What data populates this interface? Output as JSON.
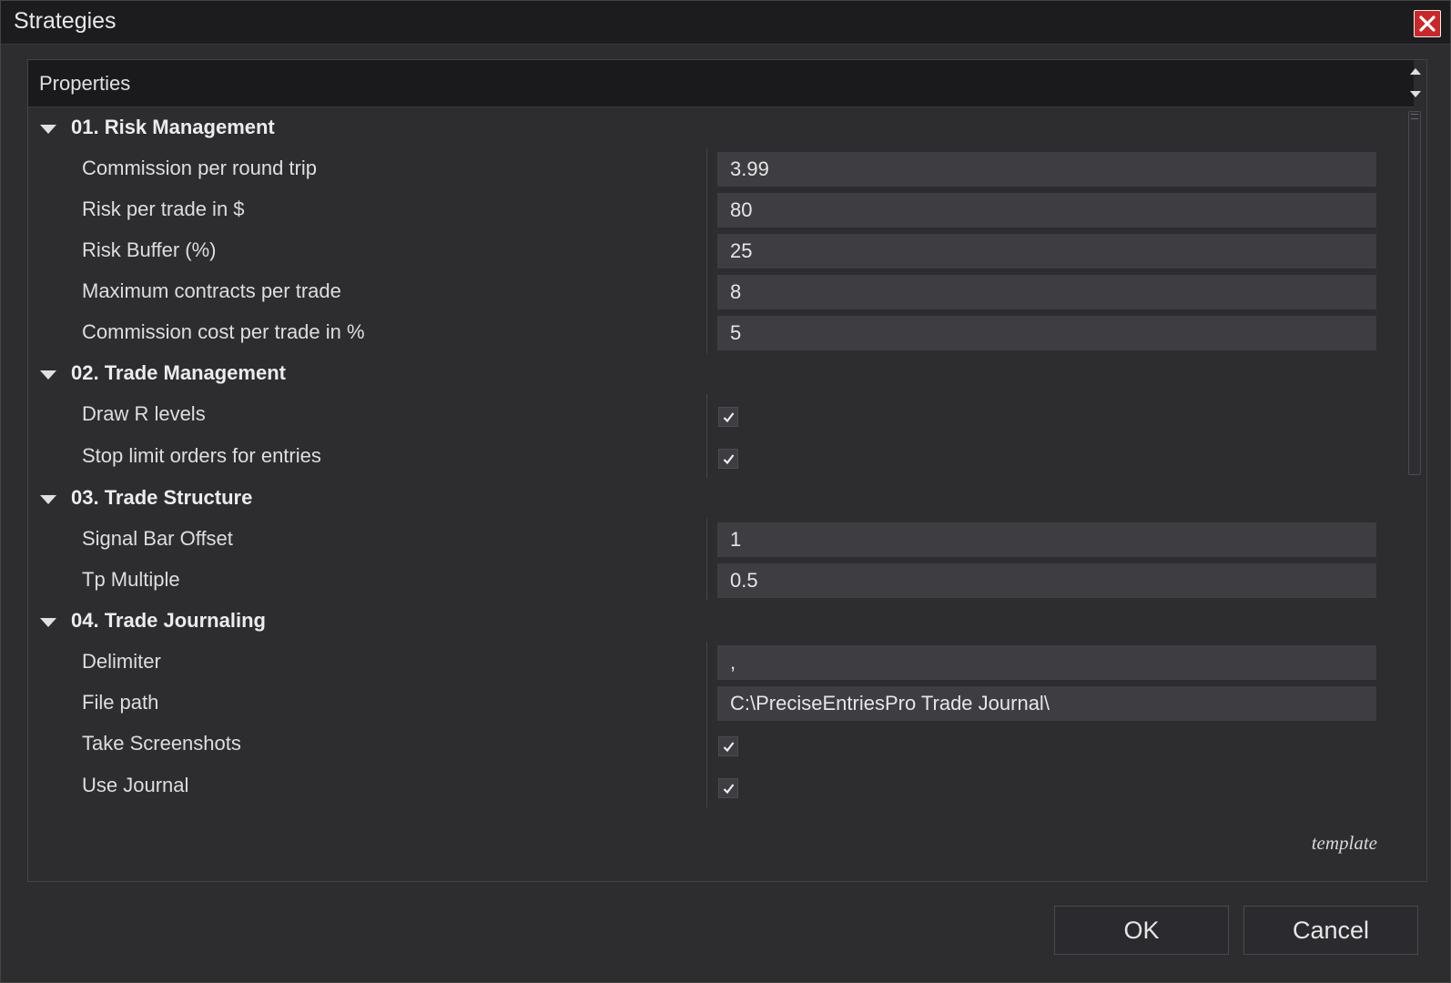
{
  "window": {
    "title": "Strategies"
  },
  "panel": {
    "header": "Properties",
    "template_label": "template"
  },
  "categories": [
    {
      "label": "01. Risk Management",
      "properties": [
        {
          "name": "Commission per round trip",
          "type": "text",
          "value": "3.99"
        },
        {
          "name": "Risk per trade in $",
          "type": "text",
          "value": "80"
        },
        {
          "name": "Risk Buffer (%)",
          "type": "text",
          "value": "25"
        },
        {
          "name": "Maximum contracts per trade",
          "type": "text",
          "value": "8"
        },
        {
          "name": "Commission cost per trade in %",
          "type": "text",
          "value": "5"
        }
      ]
    },
    {
      "label": "02. Trade Management",
      "properties": [
        {
          "name": "Draw R levels",
          "type": "checkbox",
          "checked": true
        },
        {
          "name": "Stop limit orders for entries",
          "type": "checkbox",
          "checked": true
        }
      ]
    },
    {
      "label": "03. Trade Structure",
      "properties": [
        {
          "name": "Signal Bar Offset",
          "type": "text",
          "value": "1"
        },
        {
          "name": "Tp Multiple",
          "type": "text",
          "value": "0.5"
        }
      ]
    },
    {
      "label": "04. Trade Journaling",
      "properties": [
        {
          "name": "Delimiter",
          "type": "text",
          "value": ","
        },
        {
          "name": "File path",
          "type": "text",
          "value": "C:\\PreciseEntriesPro Trade Journal\\"
        },
        {
          "name": "Take Screenshots",
          "type": "checkbox",
          "checked": true
        },
        {
          "name": "Use Journal",
          "type": "checkbox",
          "checked": true
        }
      ]
    }
  ],
  "buttons": {
    "ok": "OK",
    "cancel": "Cancel"
  },
  "colors": {
    "close_button": "#c8282a",
    "background": "#2d2d30",
    "input_background": "#3d3d42"
  }
}
